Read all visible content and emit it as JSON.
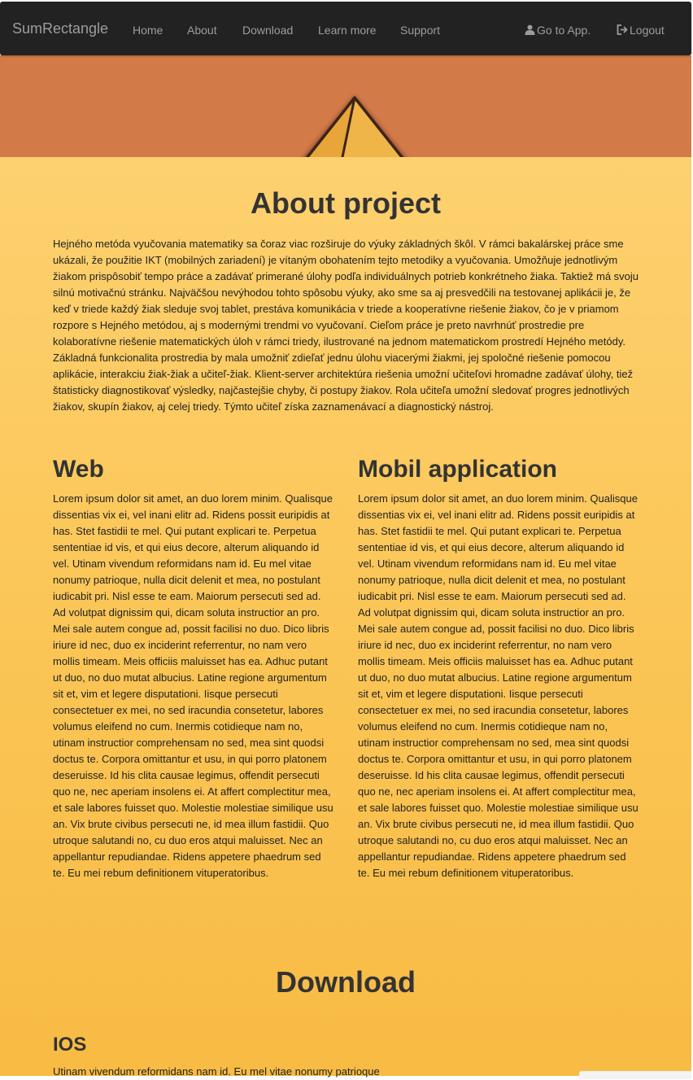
{
  "navbar": {
    "brand": "SumRectangle",
    "links": [
      "Home",
      "About",
      "Download",
      "Learn more",
      "Support"
    ],
    "go_to_app": "Go to App.",
    "logout": "Logout"
  },
  "icons": {
    "user": "user-icon",
    "logout": "logout-icon",
    "pyramid": "pyramid-logo"
  },
  "colors": {
    "navbar": "#222222",
    "hero": "#d37a49",
    "content": "#fbc657"
  },
  "about": {
    "title": "About project",
    "text": "Hejného metóda vyučovania matematiky sa čoraz viac rozširuje do výuky základných škôl. V rámci bakalárskej práce sme ukázali, že použitie IKT (mobilných zariadení) je vítaným obohatením tejto metodiky a vyučovania. Umožňuje jednotlivým žiakom prispôsobiť tempo práce a zadávať primerané úlohy podľa individuálnych potrieb konkrétneho žiaka. Taktiež má svoju silnú motivačnú stránku. Najväčšou nevýhodou tohto spôsobu výuky, ako sme sa aj presvedčili na testovanej aplikácii je, že keď v triede každý žiak sleduje svoj tablet, prestáva komunikácia v triede a kooperatívne riešenie žiakov, čo je v priamom rozpore s Hejného metódou, aj s modernými trendmi vo vyučovaní. Cieľom práce je preto navrhnúť prostredie pre kolaboratívne riešenie matematických úloh v rámci triedy, ilustrované na jednom matematickom prostredí Hejného metódy. Základná funkcionalita prostredia by mala umožniť zdieľať jednu úlohu viacerými žiakmi, jej spoločné riešenie pomocou aplikácie, interakciu žiak-žiak a učiteľ-žiak. Klient-server architektúra riešenia umožní učiteľovi hromadne zadávať úlohy, tiež štatisticky diagnostikovať výsledky, najčastejšie chyby, či postupy žiakov. Rola učiteľa umožní sledovať progres jednotlivých žiakov, skupín žiakov, aj celej triedy. Týmto učiteľ získa zaznamenávací a diagnostický nástroj."
  },
  "web": {
    "title": "Web",
    "text": "Lorem ipsum dolor sit amet, an duo lorem minim. Qualisque dissentias vix ei, vel inani elitr ad. Ridens possit euripidis at has. Stet fastidii te mel. Qui putant explicari te. Perpetua sententiae id vis, et qui eius decore, alterum aliquando id vel. Utinam vivendum reformidans nam id. Eu mel vitae nonumy patrioque, nulla dicit delenit et mea, no postulant iudicabit pri. Nisl esse te eam. Maiorum persecuti sed ad. Ad volutpat dignissim qui, dicam soluta instructior an pro. Mei sale autem congue ad, possit facilisi no duo. Dico libris iriure id nec, duo ex inciderint referrentur, no nam vero mollis timeam. Meis officiis maluisset has ea. Adhuc putant ut duo, no duo mutat albucius. Latine regione argumentum sit et, vim et legere disputationi. Iisque persecuti consectetuer ex mei, no sed iracundia consetetur, labores volumus eleifend no cum. Inermis cotidieque nam no, utinam instructior comprehensam no sed, mea sint quodsi doctus te. Corpora omittantur et usu, in qui porro platonem deseruisse. Id his clita causae legimus, offendit persecuti quo ne, nec aperiam insolens ei. At affert complectitur mea, et sale labores fuisset quo. Molestie molestiae similique usu an. Vix brute civibus persecuti ne, id mea illum fastidii. Quo utroque salutandi no, cu duo eros atqui maluisset. Nec an appellantur repudiandae. Ridens appetere phaedrum sed te. Eu mei rebum definitionem vituperatoribus."
  },
  "mobile": {
    "title": "Mobil application",
    "text": "Lorem ipsum dolor sit amet, an duo lorem minim. Qualisque dissentias vix ei, vel inani elitr ad. Ridens possit euripidis at has. Stet fastidii te mel. Qui putant explicari te. Perpetua sententiae id vis, et qui eius decore, alterum aliquando id vel. Utinam vivendum reformidans nam id. Eu mel vitae nonumy patrioque, nulla dicit delenit et mea, no postulant iudicabit pri. Nisl esse te eam. Maiorum persecuti sed ad. Ad volutpat dignissim qui, dicam soluta instructior an pro. Mei sale autem congue ad, possit facilisi no duo. Dico libris iriure id nec, duo ex inciderint referrentur, no nam vero mollis timeam. Meis officiis maluisset has ea. Adhuc putant ut duo, no duo mutat albucius. Latine regione argumentum sit et, vim et legere disputationi. Iisque persecuti consectetuer ex mei, no sed iracundia consetetur, labores volumus eleifend no cum. Inermis cotidieque nam no, utinam instructior comprehensam no sed, mea sint quodsi doctus te. Corpora omittantur et usu, in qui porro platonem deseruisse. Id his clita causae legimus, offendit persecuti quo ne, nec aperiam insolens ei. At affert complectitur mea, et sale labores fuisset quo. Molestie molestiae similique usu an. Vix brute civibus persecuti ne, id mea illum fastidii. Quo utroque salutandi no, cu duo eros atqui maluisset. Nec an appellantur repudiandae. Ridens appetere phaedrum sed te. Eu mei rebum definitionem vituperatoribus."
  },
  "download": {
    "title": "Download",
    "ios_title": "IOS",
    "ios_text": "Utinam vivendum reformidans nam id. Eu mel vitae nonumy patrioque"
  }
}
